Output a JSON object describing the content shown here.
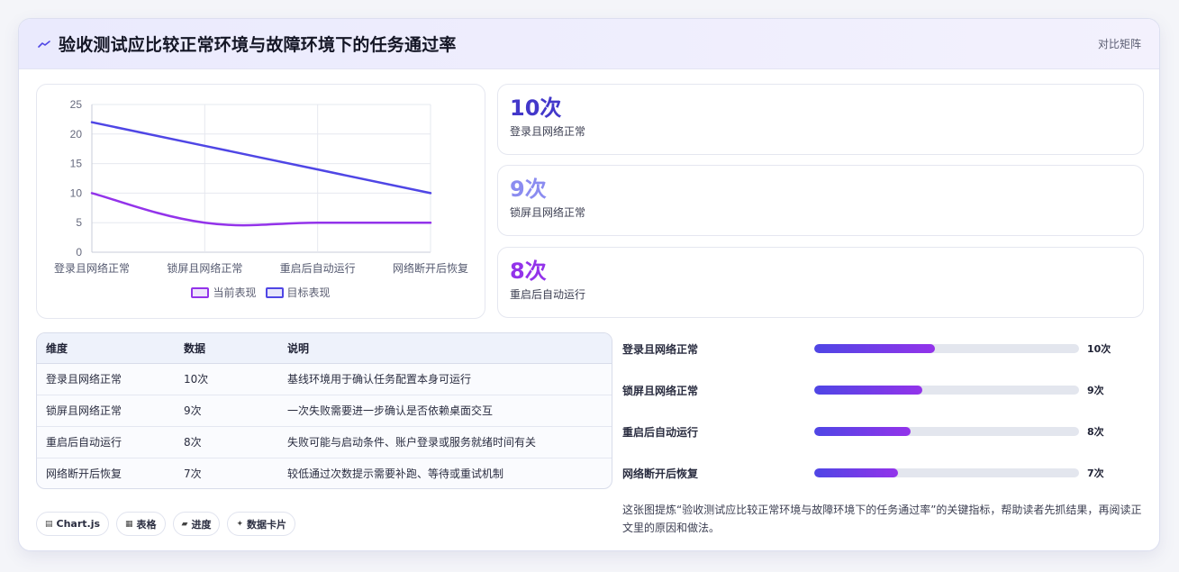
{
  "header": {
    "title": "验收测试应比较正常环境与故障环境下的任务通过率",
    "tag": "对比矩阵"
  },
  "chart_data": {
    "type": "line",
    "categories": [
      "登录且网络正常",
      "锁屏且网络正常",
      "重启后自动运行",
      "网络断开后恢复"
    ],
    "series": [
      {
        "name": "当前表现",
        "values": [
          10,
          5,
          5,
          5
        ],
        "color": "#9333ea"
      },
      {
        "name": "目标表现",
        "values": [
          22,
          18,
          14,
          10
        ],
        "color": "#4f46e5"
      }
    ],
    "ylim": [
      0,
      25
    ],
    "yticks": [
      0,
      5,
      10,
      15,
      20,
      25
    ],
    "grid": true,
    "legend": "bottom"
  },
  "stats": [
    {
      "value": "10次",
      "label": "登录且网络正常",
      "color": "#4338ca"
    },
    {
      "value": "9次",
      "label": "锁屏且网络正常",
      "color": "#8b8cf0"
    },
    {
      "value": "8次",
      "label": "重启后自动运行",
      "color": "#9333ea"
    }
  ],
  "table": {
    "headers": [
      "维度",
      "数据",
      "说明"
    ],
    "rows": [
      [
        "登录且网络正常",
        "10次",
        "基线环境用于确认任务配置本身可运行"
      ],
      [
        "锁屏且网络正常",
        "9次",
        "一次失败需要进一步确认是否依赖桌面交互"
      ],
      [
        "重启后自动运行",
        "8次",
        "失败可能与启动条件、账户登录或服务就绪时间有关"
      ],
      [
        "网络断开后恢复",
        "7次",
        "较低通过次数提示需要补跑、等待或重试机制"
      ]
    ]
  },
  "progress": [
    {
      "label": "登录且网络正常",
      "value": "10次",
      "fraction": 0.455
    },
    {
      "label": "锁屏且网络正常",
      "value": "9次",
      "fraction": 0.409
    },
    {
      "label": "重启后自动运行",
      "value": "8次",
      "fraction": 0.364
    },
    {
      "label": "网络断开后恢复",
      "value": "7次",
      "fraction": 0.318
    }
  ],
  "pills": [
    {
      "icon": "chart-icon",
      "glyph": "▤",
      "label": "Chart.js"
    },
    {
      "icon": "table-icon",
      "glyph": "▦",
      "label": "表格"
    },
    {
      "icon": "progress-icon",
      "glyph": "▰",
      "label": "进度"
    },
    {
      "icon": "sparkle-icon",
      "glyph": "✦",
      "label": "数据卡片"
    }
  ],
  "note": "这张图提炼“验收测试应比较正常环境与故障环境下的任务通过率”的关键指标，帮助读者先抓结果，再阅读正文里的原因和做法。"
}
